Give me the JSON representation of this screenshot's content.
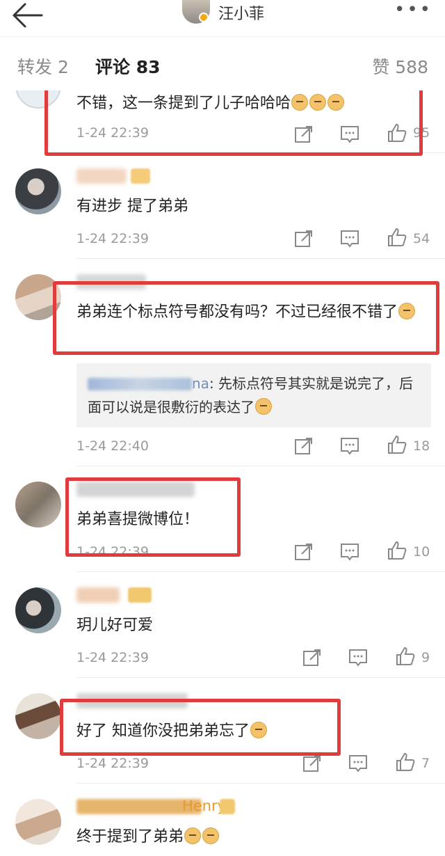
{
  "header": {
    "title": "汪小菲"
  },
  "tabs": {
    "repost": "转发 2",
    "comments": "评论 83",
    "likes": "赞 588"
  },
  "comments": [
    {
      "text": "不错，这一条提到了儿子哈哈哈",
      "time": "1-24 22:39",
      "likes": "95"
    },
    {
      "text": "有进步 提了弟弟",
      "time": "1-24 22:39",
      "likes": "54"
    },
    {
      "text": "弟弟连个标点符号都没有吗？不过已经很不错了",
      "time": "1-24 22:40",
      "likes": "18",
      "reply": {
        "name_suffix": "na",
        "text": ": 先标点符号其实就是说完了，后面可以说是很敷衍的表达了"
      }
    },
    {
      "text": "弟弟喜提微博位！",
      "time": "1-24 22:39",
      "likes": "10"
    },
    {
      "text": "玥儿好可爱",
      "time": "1-24 22:39",
      "likes": "9"
    },
    {
      "text": "好了 知道你没把弟弟忘了",
      "time": "1-24 22:39",
      "likes": "7"
    },
    {
      "text": "终于提到了弟弟",
      "username": "Henry"
    }
  ],
  "icons": {
    "back": "arrow-left-icon",
    "more": "more-dots-icon",
    "share": "share-icon",
    "comment": "comment-icon",
    "like": "thumbs-up-icon",
    "emoji": "doge-emoji-icon"
  },
  "colors": {
    "highlight_box": "#e03c3c",
    "meta_text": "#9a9a9a",
    "verified_badge": "#f3a815"
  }
}
